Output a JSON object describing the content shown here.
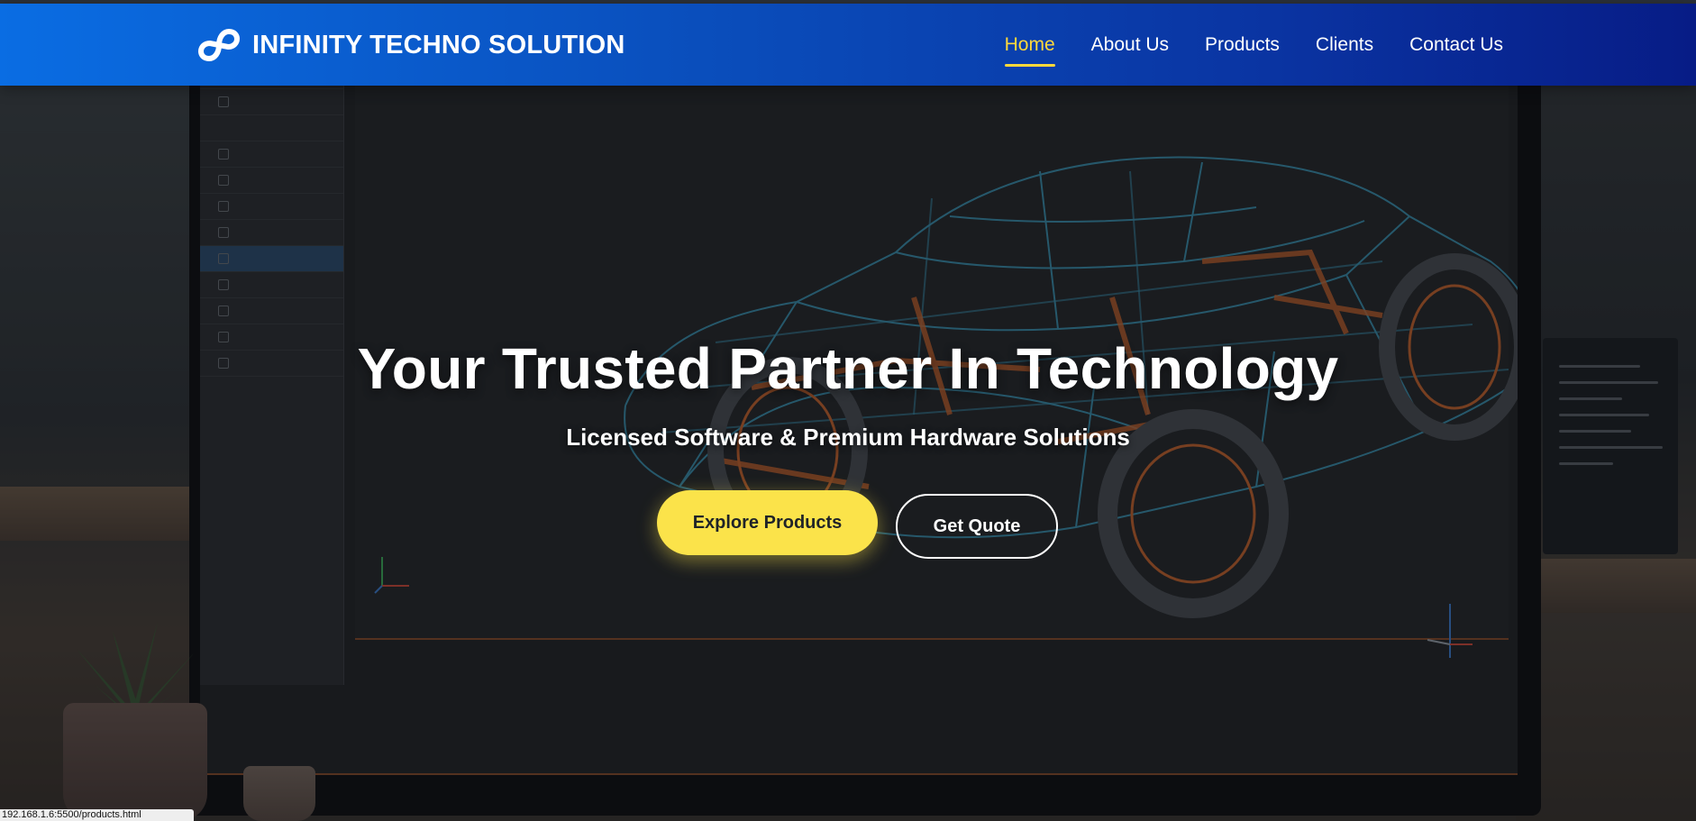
{
  "brand": {
    "name": "INFINITY TECHNO SOLUTION",
    "logo_icon": "infinity-logo-icon"
  },
  "nav": {
    "items": [
      {
        "label": "Home",
        "active": true
      },
      {
        "label": "About Us",
        "active": false
      },
      {
        "label": "Products",
        "active": false
      },
      {
        "label": "Clients",
        "active": false
      },
      {
        "label": "Contact Us",
        "active": false
      }
    ]
  },
  "hero": {
    "title": "Your Trusted Partner In Technology",
    "subtitle": "Licensed Software & Premium Hardware Solutions",
    "primary_cta": "Explore Products",
    "secondary_cta": "Get Quote"
  },
  "status_url": "192.168.1.6:5500/products.html",
  "colors": {
    "nav_gradient_start": "#0a6de3",
    "nav_gradient_end": "#071c86",
    "accent_yellow": "#fbe34a",
    "active_nav": "#ffd93b"
  }
}
